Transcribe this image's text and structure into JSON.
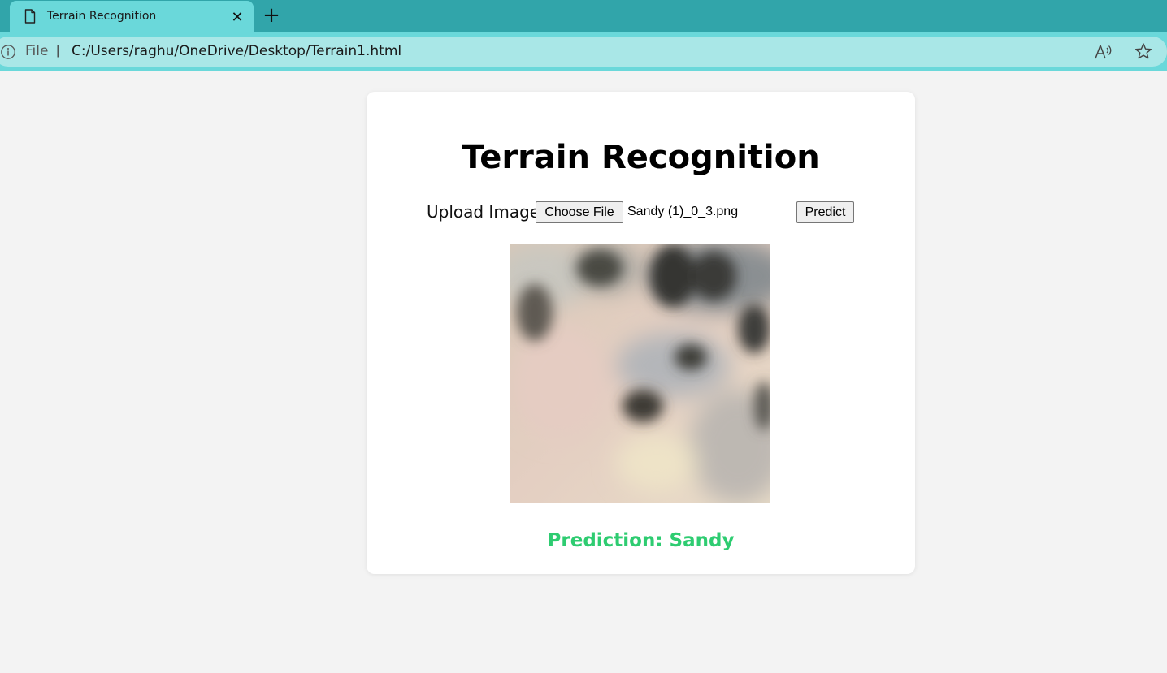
{
  "browser": {
    "tab_title": "Terrain Recognition",
    "address_prefix": "File",
    "address_separator": "|",
    "url": "C:/Users/raghu/OneDrive/Desktop/Terrain1.html"
  },
  "page": {
    "title": "Terrain Recognition",
    "upload_label": "Upload Image:",
    "choose_file_label": "Choose File",
    "selected_file": "Sandy (1)_0_3.png",
    "predict_label": "Predict",
    "prediction_text": "Prediction: Sandy",
    "prediction_color": "#2ecc71"
  },
  "icons": {
    "tab": "document-icon",
    "close": "close-icon",
    "new_tab": "plus-icon",
    "info": "info-icon",
    "read_aloud": "read-aloud-icon",
    "favorite": "star-icon"
  }
}
